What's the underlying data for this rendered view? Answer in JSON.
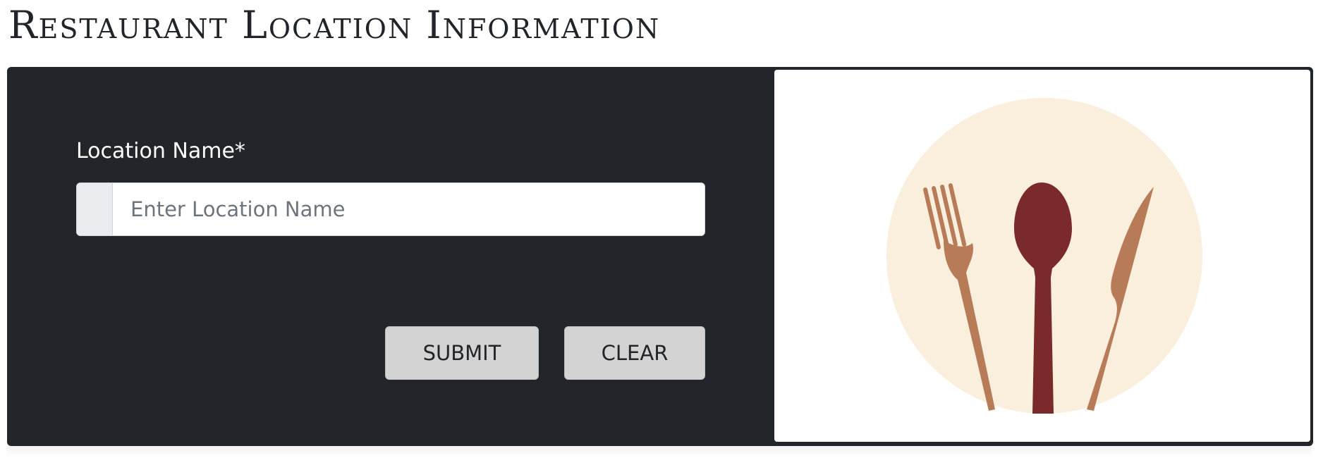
{
  "page": {
    "title": "Restaurant Location Information"
  },
  "form": {
    "location_name_label": "Location Name*",
    "location_name_placeholder": "Enter Location Name",
    "location_name_value": "",
    "submit_label": "SUBMIT",
    "clear_label": "CLEAR"
  },
  "illustration": {
    "icon": "cutlery-icon",
    "colors": {
      "plate": "#FAEEDD",
      "fork_knife": "#B77C57",
      "spoon": "#7A2A2A"
    }
  },
  "colors": {
    "card_background": "#222529",
    "button_background": "#D3D3D3",
    "input_addon": "#E9ECEF"
  }
}
